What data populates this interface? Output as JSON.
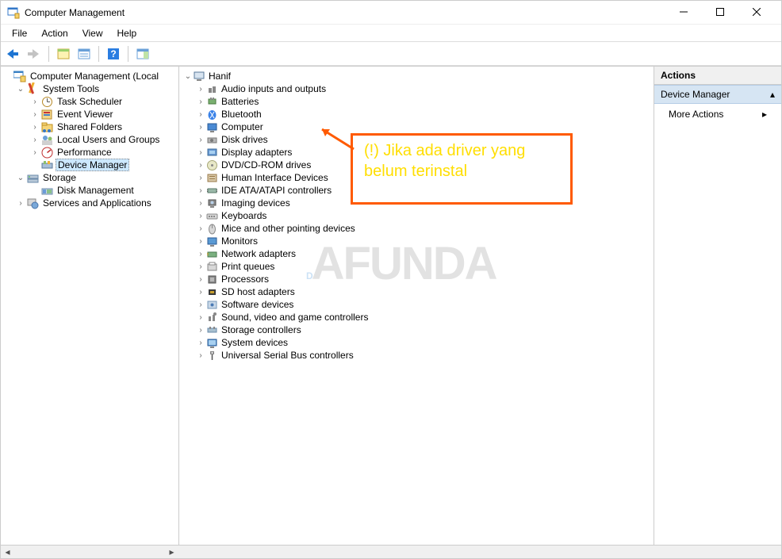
{
  "window": {
    "title": "Computer Management"
  },
  "menubar": [
    "File",
    "Action",
    "View",
    "Help"
  ],
  "sidebar": {
    "root": "Computer Management (Local",
    "system_tools": "System Tools",
    "task_scheduler": "Task Scheduler",
    "event_viewer": "Event Viewer",
    "shared_folders": "Shared Folders",
    "local_users": "Local Users and Groups",
    "performance": "Performance",
    "device_manager": "Device Manager",
    "storage": "Storage",
    "disk_management": "Disk Management",
    "services_apps": "Services and Applications"
  },
  "devices": {
    "root": "Hanif",
    "items": [
      "Audio inputs and outputs",
      "Batteries",
      "Bluetooth",
      "Computer",
      "Disk drives",
      "Display adapters",
      "DVD/CD-ROM drives",
      "Human Interface Devices",
      "IDE ATA/ATAPI controllers",
      "Imaging devices",
      "Keyboards",
      "Mice and other pointing devices",
      "Monitors",
      "Network adapters",
      "Print queues",
      "Processors",
      "SD host adapters",
      "Software devices",
      "Sound, video and game controllers",
      "Storage controllers",
      "System devices",
      "Universal Serial Bus controllers"
    ]
  },
  "actions_panel": {
    "header": "Actions",
    "section_title": "Device Manager",
    "more_actions": "More Actions"
  },
  "annotation": "(!) Jika ada driver yang belum terinstal",
  "watermark": "DAFUNDA"
}
